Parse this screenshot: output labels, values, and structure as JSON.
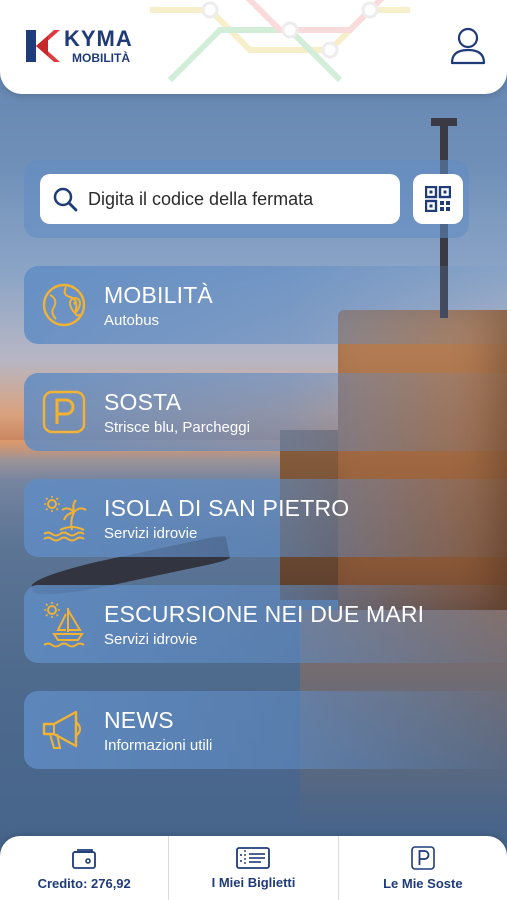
{
  "header": {
    "brand_title": "KYMA",
    "brand_subtitle": "MOBILITÀ"
  },
  "search": {
    "placeholder": "Digita il codice della fermata",
    "value": ""
  },
  "menu": [
    {
      "title": "MOBILITÀ",
      "subtitle": "Autobus",
      "icon": "globe-map-icon"
    },
    {
      "title": "SOSTA",
      "subtitle": "Strisce blu, Parcheggi",
      "icon": "parking-icon"
    },
    {
      "title": "ISOLA DI SAN PIETRO",
      "subtitle": "Servizi idrovie",
      "icon": "island-palm-icon"
    },
    {
      "title": "ESCURSIONE NEI DUE MARI",
      "subtitle": "Servizi idrovie",
      "icon": "sailboat-icon"
    },
    {
      "title": "NEWS",
      "subtitle": "Informazioni utili",
      "icon": "megaphone-icon"
    }
  ],
  "bottom_nav": [
    {
      "label": "Credito: 276,92",
      "icon": "wallet-icon"
    },
    {
      "label": "I Miei Biglietti",
      "icon": "ticket-icon"
    },
    {
      "label": "Le Mie Soste",
      "icon": "parking-icon"
    }
  ],
  "colors": {
    "brand_navy": "#1f3b78",
    "brand_red": "#e03a3e",
    "icon_gold": "#f2b233",
    "tile_blue": "#608cc4"
  }
}
